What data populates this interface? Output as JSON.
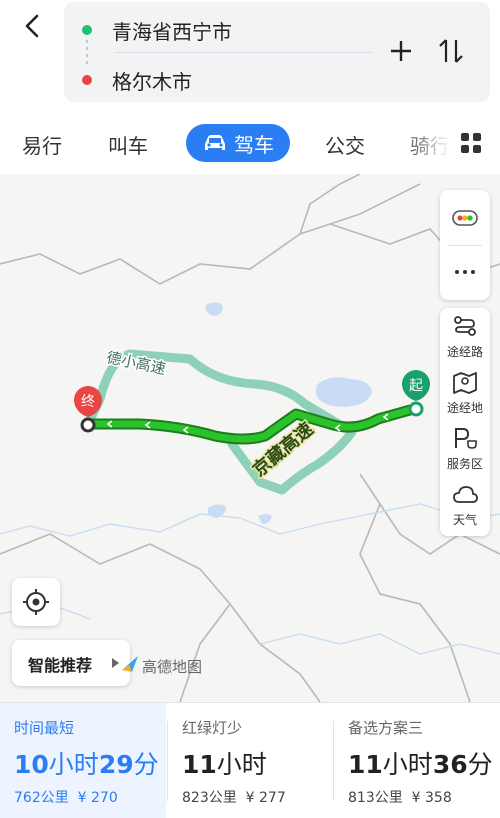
{
  "header": {
    "start": "青海省西宁市",
    "end": "格尔木市"
  },
  "tabs": {
    "t1": "易行",
    "t2": "叫车",
    "active": "驾车",
    "t4": "公交",
    "t5": "骑行"
  },
  "map": {
    "road_label_main": "京藏高速",
    "road_label_alt": "德小高速",
    "start_marker": "起",
    "end_marker": "终",
    "brand": "高德地图",
    "smart": "智能推荐"
  },
  "side": {
    "waypoint": "途经路",
    "via_place": "途经地",
    "service": "服务区",
    "weather": "天气"
  },
  "routes": [
    {
      "tag": "时间最短",
      "dur_num1": "10",
      "dur_u1": "小时",
      "dur_num2": "29",
      "dur_u2": "分",
      "dist": "762公里",
      "price": "¥ 270"
    },
    {
      "tag": "红绿灯少",
      "dur_num1": "11",
      "dur_u1": "小时",
      "dur_num2": "",
      "dur_u2": "",
      "dist": "823公里",
      "price": "¥ 277"
    },
    {
      "tag": "备选方案三",
      "dur_num1": "11",
      "dur_u1": "小时",
      "dur_num2": "36",
      "dur_u2": "分",
      "dist": "813公里",
      "price": "¥ 358"
    }
  ],
  "colors": {
    "accent": "#2a7df2",
    "route_main": "#22aa22",
    "route_alt": "#8fd0b8",
    "start_green": "#1aa06a",
    "end_red": "#e84545"
  }
}
